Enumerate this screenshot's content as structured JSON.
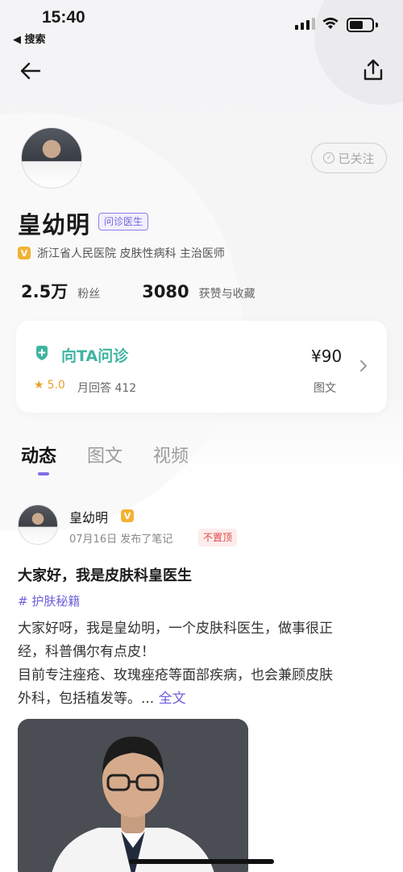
{
  "status_bar": {
    "time": "15:40",
    "back_app": "◀ 搜索"
  },
  "nav": {
    "back_icon": "arrow-left-icon",
    "share_icon": "share-icon"
  },
  "profile": {
    "name": "皇幼明",
    "role_tag": "问诊医生",
    "verify_text": "浙江省人民医院 皮肤性病科 主治医师",
    "follow_label": "已关注",
    "stats": [
      {
        "value": "2.5万",
        "label": "粉丝"
      },
      {
        "value": "3080",
        "label": "获赞与收藏"
      }
    ]
  },
  "consult": {
    "title": "向TA问诊",
    "rating": "5.0",
    "monthly": "月回答 412",
    "price": "¥90",
    "type": "图文"
  },
  "tabs": [
    {
      "label": "动态",
      "active": true
    },
    {
      "label": "图文",
      "active": false
    },
    {
      "label": "视频",
      "active": false
    }
  ],
  "post": {
    "author": "皇幼明",
    "meta": "07月16日 发布了笔记",
    "unpin_label": "不置顶",
    "title": "大家好，我是皮肤科皇医生",
    "topic": "# 护肤秘籍",
    "body_lines": [
      "大家好呀，我是皇幼明，一个皮肤科医生，做事很正",
      "经，科普偶尔有点皮！",
      "目前专注痤疮、玫瑰痤疮等面部疾病，也会兼顾皮肤",
      "外科，包括植发等。..."
    ],
    "more_label": "全文"
  },
  "colors": {
    "accent_purple": "#7466dd",
    "consult_green": "#3fb4a0",
    "star_orange": "#e7a22d",
    "verify_gold": "#f3b234",
    "unpin_red": "#e04848"
  }
}
